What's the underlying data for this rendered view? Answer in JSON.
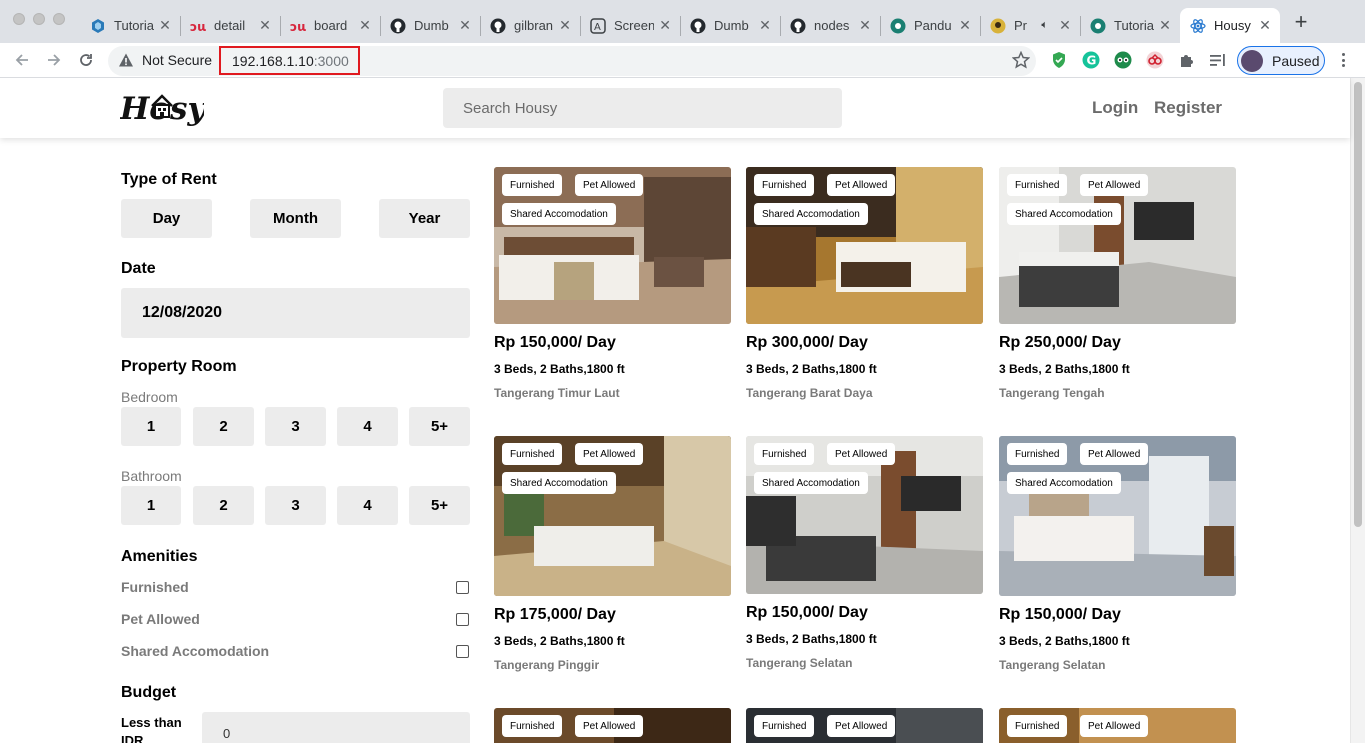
{
  "browser": {
    "tabs": [
      {
        "title": "Tutoria",
        "icon": "react-hexagon-icon"
      },
      {
        "title": "detail",
        "icon": "dw-logo-icon"
      },
      {
        "title": "board",
        "icon": "dw-logo-icon"
      },
      {
        "title": "Dumb",
        "icon": "github-icon"
      },
      {
        "title": "gilbran",
        "icon": "github-icon"
      },
      {
        "title": "Screen",
        "icon": "screenshot-app-icon"
      },
      {
        "title": "Dumb",
        "icon": "github-icon"
      },
      {
        "title": "nodes",
        "icon": "github-icon"
      },
      {
        "title": "Pandu",
        "icon": "teal-circle-icon"
      },
      {
        "title": "Pr",
        "icon": "avatar-icon"
      },
      {
        "title": "Tutoria",
        "icon": "teal-circle-icon"
      },
      {
        "title": "Housy",
        "icon": "react-icon"
      }
    ],
    "security_label": "Not Secure",
    "url_host": "192.168.1.10",
    "url_port": ":3000",
    "profile_label": "Paused"
  },
  "header": {
    "logo_text": "Housy",
    "search_placeholder": "Search Housy",
    "login": "Login",
    "register": "Register"
  },
  "sidebar": {
    "type_of_rent": {
      "title": "Type of Rent",
      "options": [
        "Day",
        "Month",
        "Year"
      ]
    },
    "date": {
      "title": "Date",
      "value": "12/08/2020"
    },
    "property_room": {
      "title": "Property Room",
      "bedroom_label": "Bedroom",
      "bedroom_options": [
        "1",
        "2",
        "3",
        "4",
        "5+"
      ],
      "bathroom_label": "Bathroom",
      "bathroom_options": [
        "1",
        "2",
        "3",
        "4",
        "5+"
      ]
    },
    "amenities": {
      "title": "Amenities",
      "items": [
        "Furnished",
        "Pet Allowed",
        "Shared Accomodation"
      ]
    },
    "budget": {
      "title": "Budget",
      "less_than": "Less than",
      "currency": "IDR",
      "value": "0"
    }
  },
  "listings": [
    {
      "badges": [
        "Furnished",
        "Pet Allowed",
        "Shared Accomodation"
      ],
      "price": "Rp 150,000/ Day",
      "specs": "3 Beds, 2 Baths,1800 ft",
      "location": "Tangerang Timur Laut"
    },
    {
      "badges": [
        "Furnished",
        "Pet Allowed",
        "Shared Accomodation"
      ],
      "price": "Rp 300,000/ Day",
      "specs": "3 Beds, 2 Baths,1800 ft",
      "location": "Tangerang Barat Daya"
    },
    {
      "badges": [
        "Furnished",
        "Pet Allowed",
        "Shared Accomodation"
      ],
      "price": "Rp 250,000/ Day",
      "specs": "3 Beds, 2 Baths,1800 ft",
      "location": "Tangerang Tengah"
    },
    {
      "badges": [
        "Furnished",
        "Pet Allowed",
        "Shared Accomodation"
      ],
      "price": "Rp 175,000/ Day",
      "specs": "3 Beds, 2 Baths,1800 ft",
      "location": "Tangerang Pinggir"
    },
    {
      "badges": [
        "Furnished",
        "Pet Allowed",
        "Shared Accomodation"
      ],
      "price": "Rp 150,000/ Day",
      "specs": "3 Beds, 2 Baths,1800 ft",
      "location": "Tangerang Selatan"
    },
    {
      "badges": [
        "Furnished",
        "Pet Allowed",
        "Shared Accomodation"
      ],
      "price": "Rp 150,000/ Day",
      "specs": "3 Beds, 2 Baths,1800 ft",
      "location": "Tangerang Selatan"
    },
    {
      "badges": [
        "Furnished",
        "Pet Allowed"
      ]
    },
    {
      "badges": [
        "Furnished",
        "Pet Allowed"
      ]
    },
    {
      "badges": [
        "Furnished",
        "Pet Allowed"
      ]
    }
  ]
}
